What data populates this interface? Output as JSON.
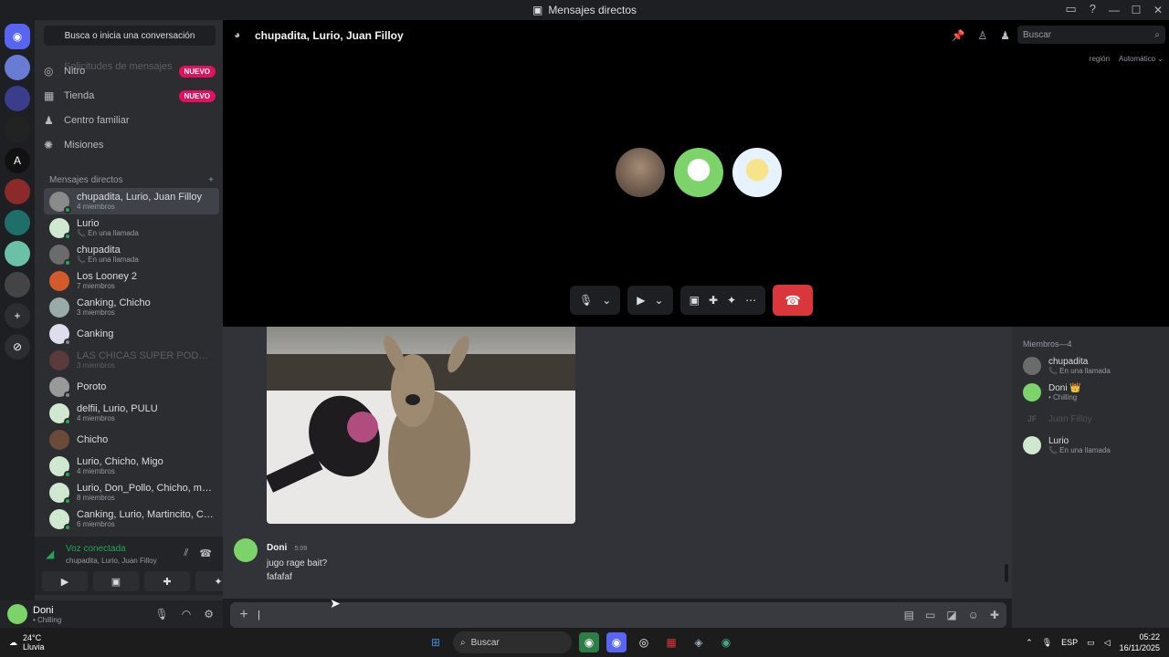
{
  "window": {
    "title": "Mensajes directos",
    "controls": [
      "—",
      "☐",
      "✕"
    ]
  },
  "dm_panel": {
    "search_label": "Busca o inicia una conversación",
    "partial_item": "Solicitudes de mensajes",
    "nav": [
      {
        "label": "Nitro",
        "badge": "NUEVO",
        "icon": "nitro-icon"
      },
      {
        "label": "Tienda",
        "badge": "NUEVO",
        "icon": "shop-icon"
      },
      {
        "label": "Centro familiar",
        "badge": "",
        "icon": "family-icon"
      },
      {
        "label": "Misiones",
        "badge": "",
        "icon": "quests-icon"
      }
    ],
    "dm_header": "Mensajes directos",
    "dms": [
      {
        "name": "chupadita, Lurio, Juan Filloy",
        "sub": "4 miembros",
        "active": true
      },
      {
        "name": "Lurio",
        "sub": "📞 En una llamada"
      },
      {
        "name": "chupadita",
        "sub": "📞 En una llamada"
      },
      {
        "name": "Los Looney 2",
        "sub": "7 miembros"
      },
      {
        "name": "Canking, Chicho",
        "sub": "3 miembros"
      },
      {
        "name": "Canking",
        "sub": ""
      },
      {
        "name": "LAS CHICAS SUPER PODERO...",
        "sub": "3 miembros",
        "faded": true
      },
      {
        "name": "Poroto",
        "sub": ""
      },
      {
        "name": "delfii, Lurio, PULU",
        "sub": "4 miembros"
      },
      {
        "name": "Chicho",
        "sub": ""
      },
      {
        "name": "Lurio, Chicho, Migo",
        "sub": "4 miembros"
      },
      {
        "name": "Lurio, Don_Pollo, Chicho, ma...",
        "sub": "8 miembros"
      },
      {
        "name": "Canking, Lurio, Martincito, Ch...",
        "sub": "6 miembros"
      }
    ]
  },
  "voice": {
    "title": "Voz conectada",
    "channel": "chupadita, Lurio, Juan Filloy"
  },
  "user": {
    "name": "Doni",
    "status": "• Chilling"
  },
  "channel": {
    "title": "chupadita, Lurio, Juan Filloy",
    "search_placeholder": "Buscar",
    "region_label": "región",
    "region_value": "Automático ⌄"
  },
  "chat": {
    "message": {
      "author": "Doni",
      "time": "5:09",
      "lines": [
        "jugo rage bait?",
        "fafafaf"
      ]
    },
    "input_value": "|"
  },
  "members": {
    "header": "Miembros—4",
    "list": [
      {
        "name": "chupadita",
        "status": "📞 En una llamada"
      },
      {
        "name": "Doni 👑",
        "status": "• Chilling"
      },
      {
        "name": "Juan Filloy",
        "status": "",
        "faded": true,
        "initials": "JF"
      },
      {
        "name": "Lurio",
        "status": "📞 En una llamada"
      }
    ]
  },
  "taskbar": {
    "weather_temp": "24°C",
    "weather_desc": "Lluvia",
    "search": "Buscar",
    "lang": "ESP",
    "time": "05:22",
    "date": "16/11/2025"
  },
  "colors": {
    "accent": "#5865f2",
    "online": "#23a55a",
    "hangup": "#da373c",
    "badge": "#e0115f"
  }
}
